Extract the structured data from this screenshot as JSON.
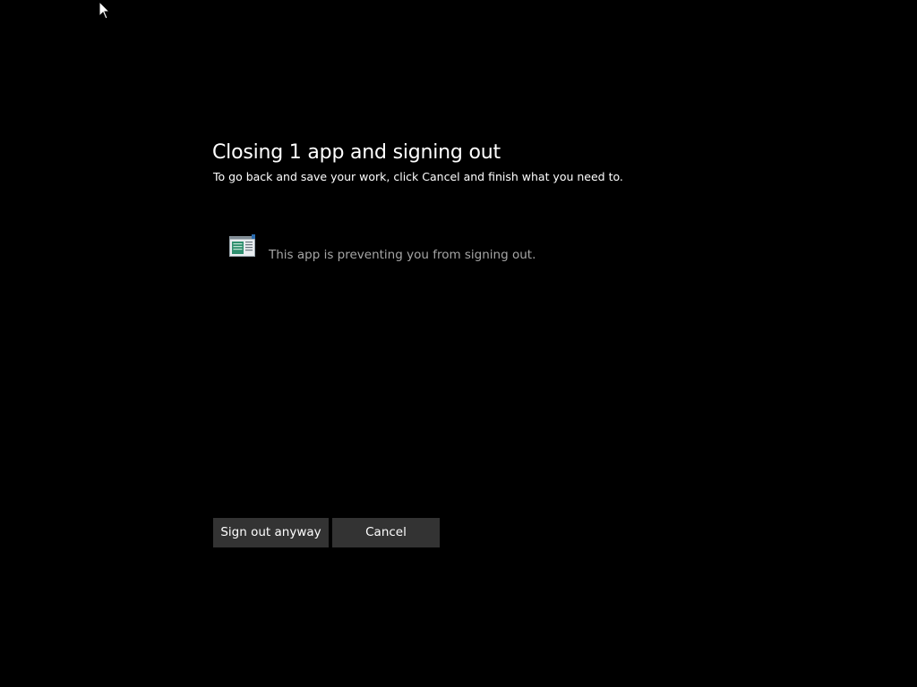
{
  "dialog": {
    "title": "Closing 1 app and signing out",
    "subtitle": "To go back and save your work, click Cancel and finish what you need to."
  },
  "blocking_apps": [
    {
      "icon": "app-window-icon",
      "message": "This app is preventing you from signing out."
    }
  ],
  "actions": {
    "sign_out_label": "Sign out anyway",
    "cancel_label": "Cancel"
  },
  "colors": {
    "background": "#000000",
    "button_background": "#333333",
    "primary_text": "#ffffff",
    "secondary_text": "#a6a6a6"
  }
}
